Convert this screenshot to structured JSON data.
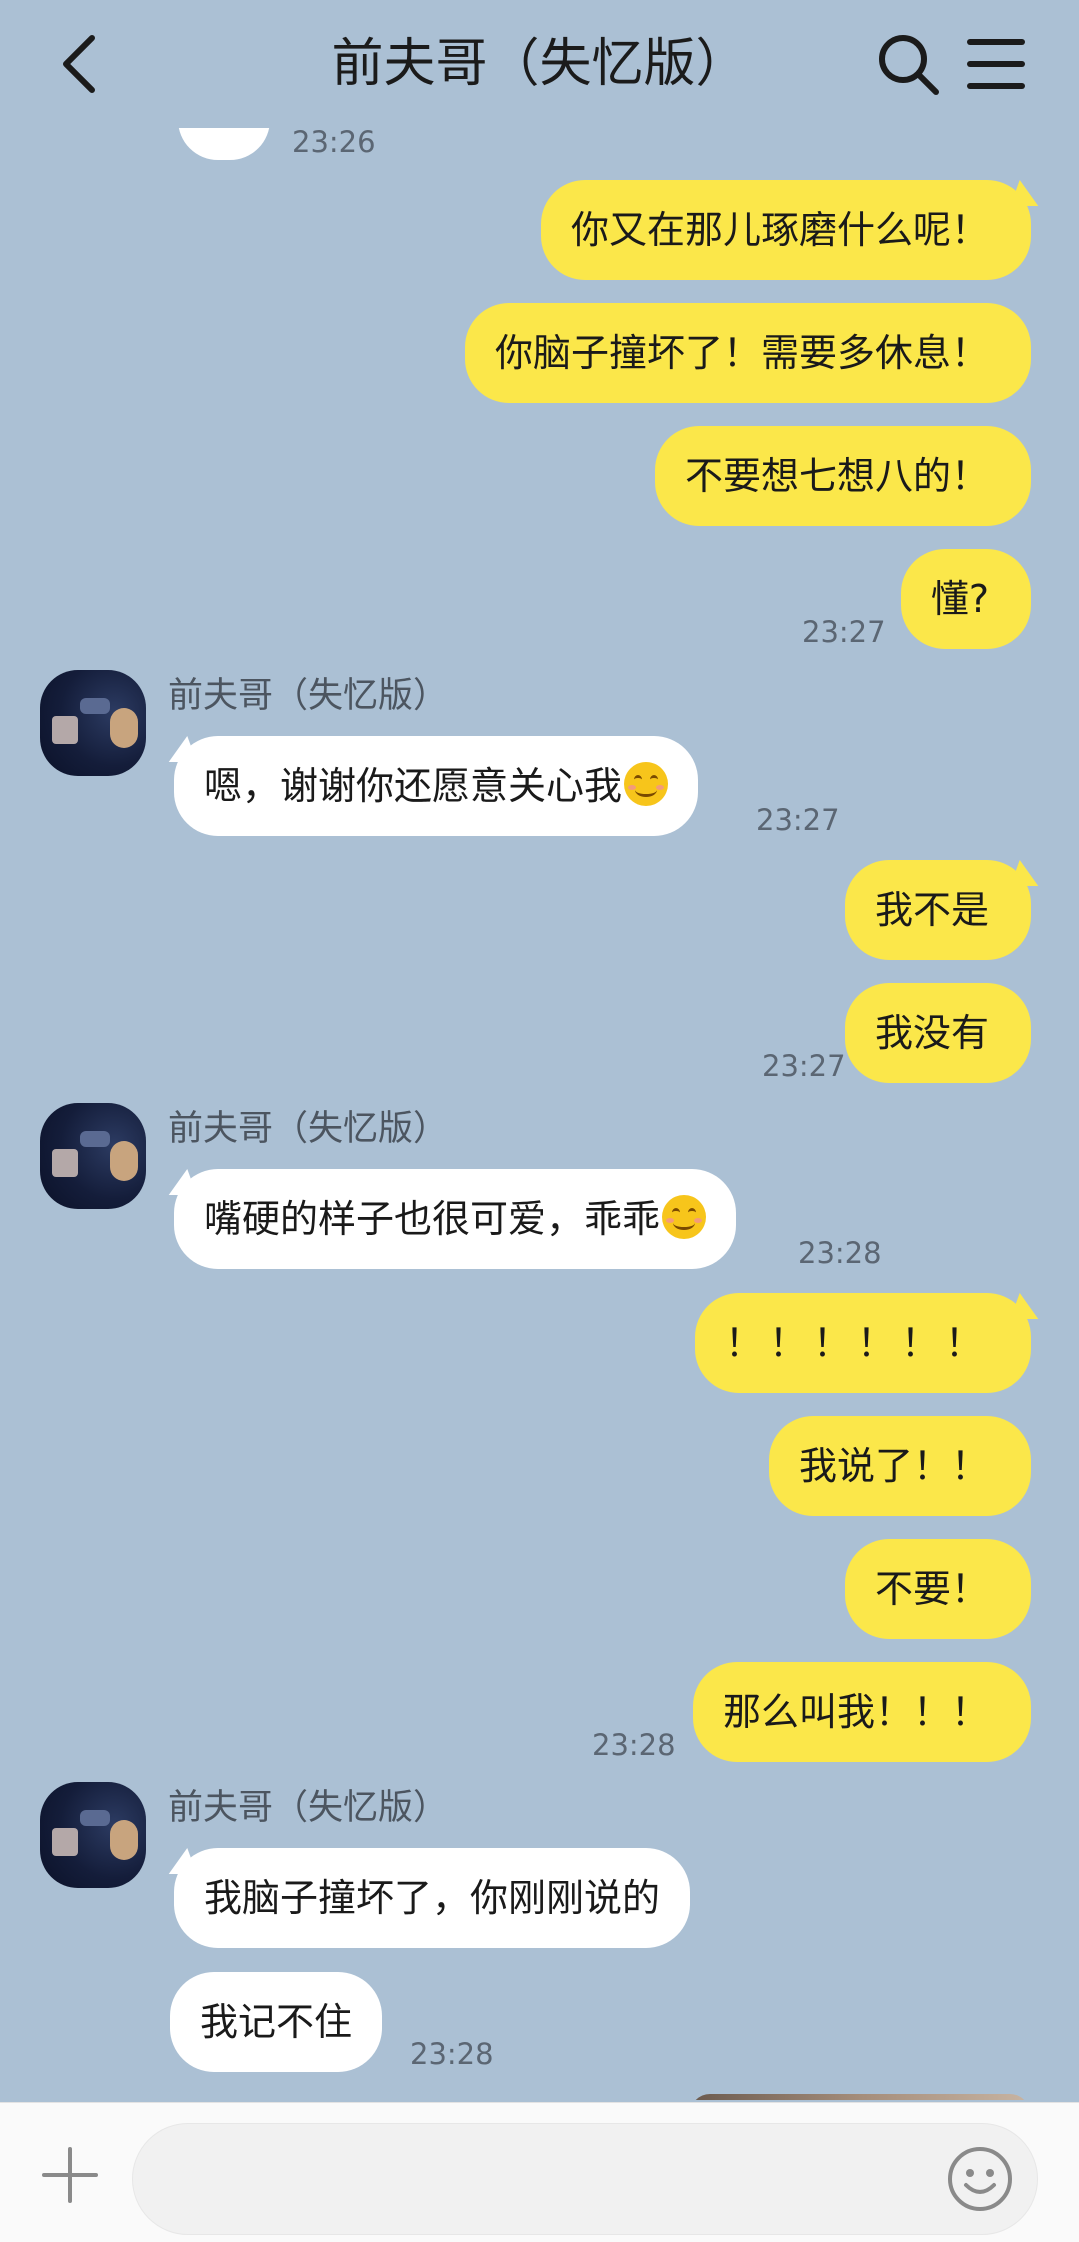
{
  "header": {
    "title": "前夫哥（失忆版）",
    "back_icon": "chevron-left-icon",
    "search_icon": "search-icon",
    "menu_icon": "menu-icon"
  },
  "messages": {
    "partial_time": "23:26",
    "out1": "你又在那儿琢磨什么呢！",
    "out2": "你脑子撞坏了！需要多休息！",
    "out3": "不要想七想八的！",
    "out4": "懂?",
    "out_time1": "23:27",
    "sender1": "前夫哥（失忆版）",
    "in1": "嗯，谢谢你还愿意关心我",
    "in_time1": "23:27",
    "out5": "我不是",
    "out6": "我没有",
    "out_time2": "23:27",
    "sender2": "前夫哥（失忆版）",
    "in2": "嘴硬的样子也很可爱，乖乖",
    "in_time2": "23:28",
    "out7": "！！！！！！",
    "out8": "我说了！！",
    "out9": "不要！",
    "out10": "那么叫我！！！",
    "out_time3": "23:28",
    "sender3": "前夫哥（失忆版）",
    "in3": "我脑子撞坏了，你刚刚说的",
    "in4": "我记不住",
    "in_time3": "23:28"
  },
  "emoji_icon": "smiling-face-icon",
  "input_bar": {
    "plus_icon": "plus-icon",
    "input_value": "",
    "emoji_button_icon": "smiley-icon"
  },
  "colors": {
    "background": "#abc0d4",
    "outgoing_bubble": "#fbe74a",
    "incoming_bubble": "#ffffff"
  }
}
